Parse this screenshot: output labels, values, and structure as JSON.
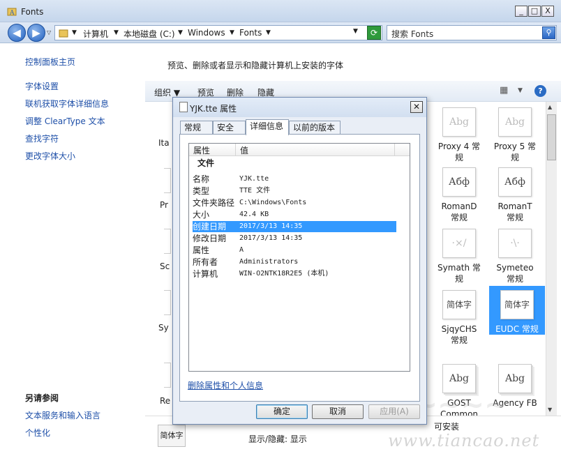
{
  "window": {
    "title": "Fonts",
    "minimize": "_",
    "maximize": "□",
    "close": "X"
  },
  "address": {
    "back": "◀",
    "forward": "▶",
    "crumbs": [
      "计算机",
      "本地磁盘 (C:)",
      "Windows",
      "Fonts"
    ],
    "search_placeholder": "搜索 Fonts"
  },
  "leftnav": {
    "home": "控制面板主页",
    "links": [
      "字体设置",
      "联机获取字体详细信息",
      "调整 ClearType 文本",
      "查找字符",
      "更改字体大小"
    ],
    "see_also_title": "另请参阅",
    "see_also": [
      "文本服务和输入语言",
      "个性化"
    ]
  },
  "main": {
    "description": "预览、删除或者显示和隐藏计算机上安装的字体",
    "toolbar": {
      "organize": "组织 ▼",
      "preview": "预览",
      "delete": "删除",
      "hide": "隐藏"
    },
    "tiles": [
      {
        "glyph": "Abg",
        "label1": "Proxy 4 常",
        "label2": "规"
      },
      {
        "glyph": "Abg",
        "label1": "Proxy 5 常",
        "label2": "规"
      },
      {
        "glyph": "Абф",
        "label1": "RomanD",
        "label2": "常规"
      },
      {
        "glyph": "Абф",
        "label1": "RomanT",
        "label2": "常规"
      },
      {
        "glyph": "·×/",
        "label1": "Symath 常",
        "label2": "规"
      },
      {
        "glyph": "·\\·",
        "label1": "Symeteo",
        "label2": "常规"
      },
      {
        "glyph": "简体字",
        "label1": "SjqyCHS",
        "label2": "常规"
      },
      {
        "glyph": "简体字",
        "label1": "EUDC 常规",
        "label2": ""
      },
      {
        "glyph": "Abg",
        "label1": "GOST",
        "label2": "Common"
      },
      {
        "glyph": "Abg",
        "label1": "Agency FB",
        "label2": ""
      }
    ],
    "partial_labels": [
      "Ita",
      "Pr",
      "Sc",
      "Sy",
      "Re"
    ],
    "details": {
      "thumb_text": "简体字",
      "installed": "可安装",
      "show_hide": "显示/隐藏: 显示"
    }
  },
  "dialog": {
    "title": "YJK.tte 属性",
    "tabs": [
      "常规",
      "安全",
      "详细信息",
      "以前的版本"
    ],
    "columns": {
      "property": "属性",
      "value": "值"
    },
    "group": "文件",
    "rows": [
      {
        "key": "名称",
        "value": "YJK.tte"
      },
      {
        "key": "类型",
        "value": "TTE 文件"
      },
      {
        "key": "文件夹路径",
        "value": "C:\\Windows\\Fonts"
      },
      {
        "key": "大小",
        "value": "42.4 KB"
      },
      {
        "key": "创建日期",
        "value": "2017/3/13 14:35"
      },
      {
        "key": "修改日期",
        "value": "2017/3/13 14:35"
      },
      {
        "key": "属性",
        "value": "A"
      },
      {
        "key": "所有者",
        "value": "Administrators"
      },
      {
        "key": "计算机",
        "value": "WIN-O2NTK18R2E5 (本机)"
      }
    ],
    "remove_link": "删除属性和个人信息",
    "ok": "确定",
    "cancel": "取消",
    "apply": "应用(A)"
  },
  "watermark": "www.tiancao.net"
}
